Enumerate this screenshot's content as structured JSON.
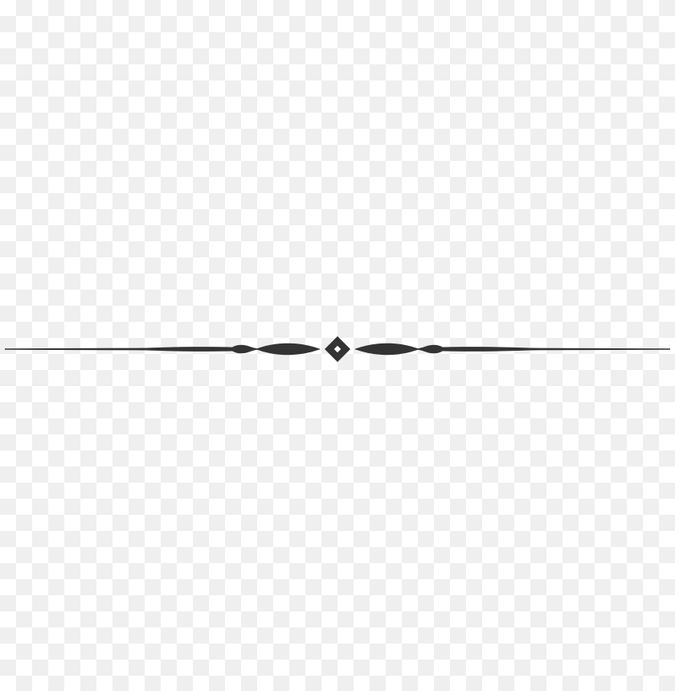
{
  "background": {
    "pattern": "transparency-checkerboard",
    "colors": [
      "#ffffff",
      "#efefef"
    ]
  },
  "ornament": {
    "type": "decorative-divider",
    "color": "#333333",
    "center_icon": "diamond-icon"
  }
}
